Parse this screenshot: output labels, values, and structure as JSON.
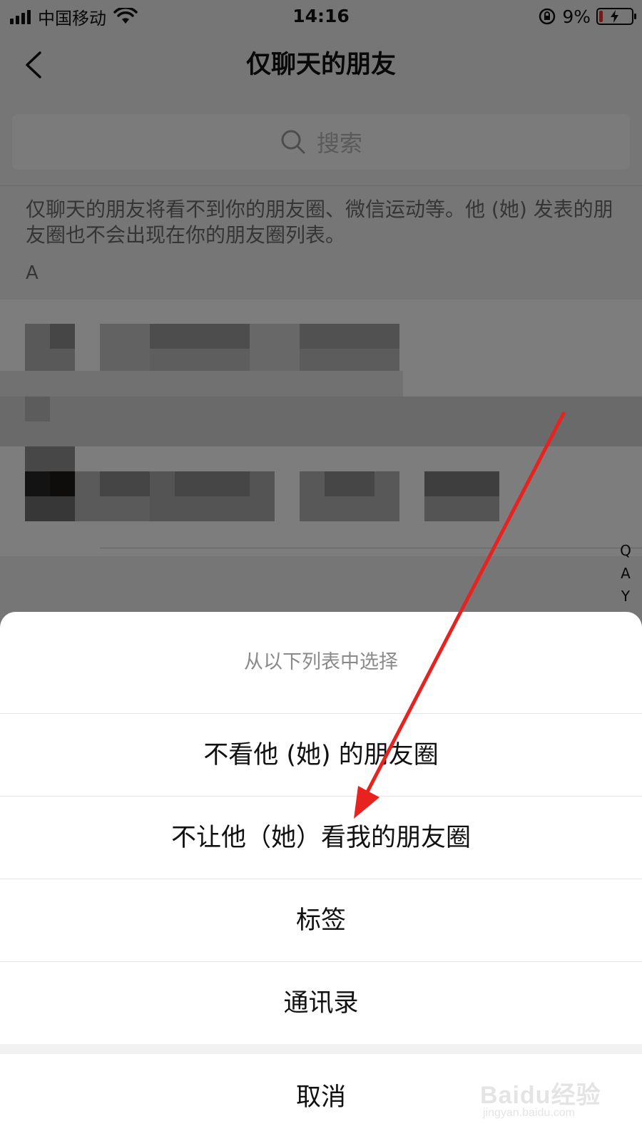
{
  "status_bar": {
    "carrier": "中国移动",
    "time": "14:16",
    "battery_percent": "9%",
    "icons": [
      "signal-icon",
      "wifi-icon",
      "rotation-lock-icon",
      "battery-charging-icon"
    ]
  },
  "nav": {
    "title": "仅聊天的朋友",
    "back_icon": "chevron-left-icon"
  },
  "search": {
    "placeholder": "搜索",
    "icon": "search-icon"
  },
  "description": "仅聊天的朋友将看不到你的朋友圈、微信运动等。他 (她) 发表的朋友圈也不会出现在你的朋友圈列表。",
  "section_letter": "A",
  "index_bar": [
    "Q",
    "A",
    "Y"
  ],
  "action_sheet": {
    "title": "从以下列表中选择",
    "items": [
      "不看他 (她) 的朋友圈",
      "不让他（她）看我的朋友圈",
      "标签",
      "通讯录"
    ],
    "cancel": "取消"
  },
  "watermark": {
    "brand": "Baidu经验",
    "url": "jingyan.baidu.com"
  },
  "colors": {
    "annotation_arrow": "#e8231f",
    "sheet_background": "#ffffff",
    "page_background": "#ededed"
  }
}
